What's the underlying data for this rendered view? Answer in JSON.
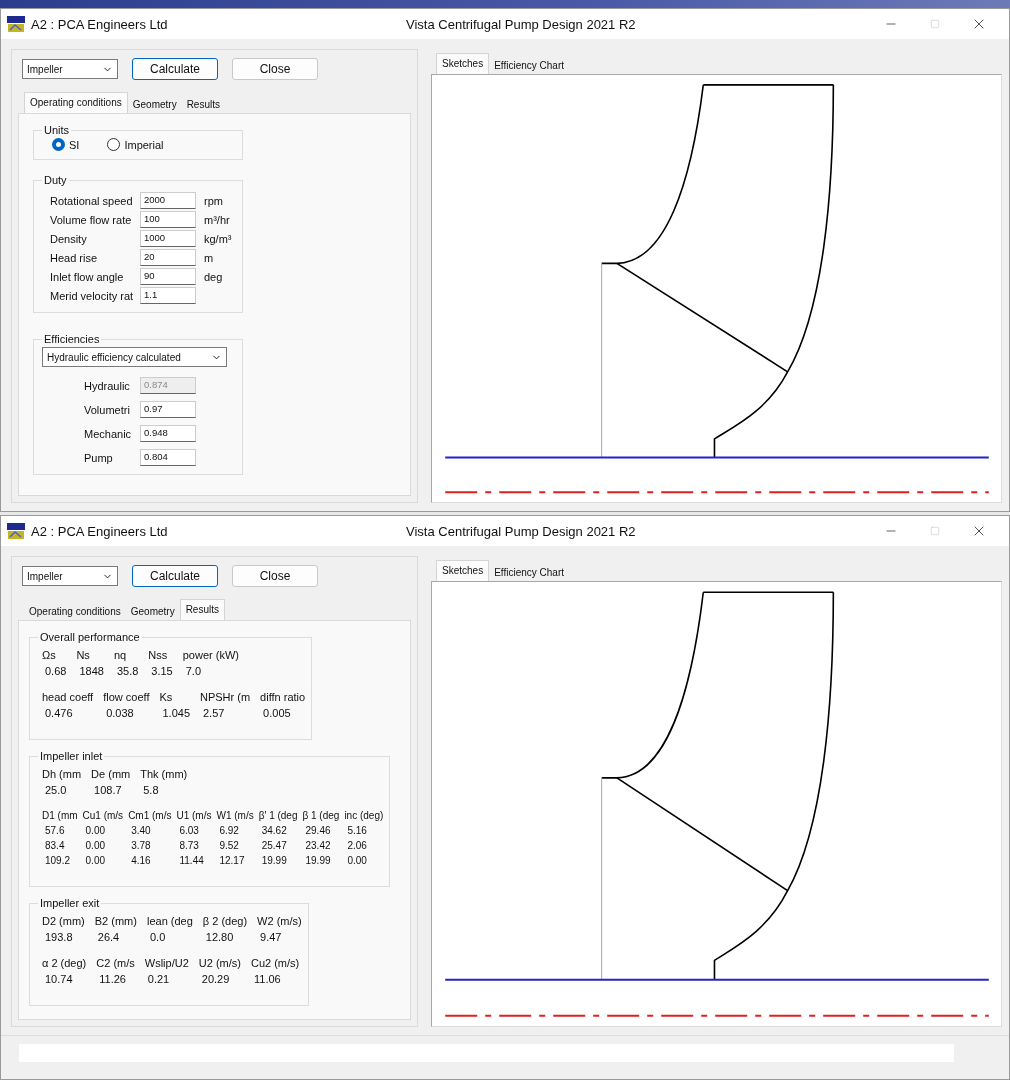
{
  "windows": [
    {
      "kind": "operating",
      "title_left": "A2 : PCA Engineers Ltd",
      "title": "Vista Centrifugal Pump Design 2021 R2",
      "component": "Impeller",
      "buttons": [
        "Calculate",
        "Close"
      ],
      "tabs": [
        {
          "label": "Operating conditions",
          "selected": true
        },
        {
          "label": "Geometry",
          "selected": false
        },
        {
          "label": "Results",
          "selected": false
        }
      ],
      "sketch_tabs": [
        {
          "label": "Sketches",
          "selected": true
        },
        {
          "label": "Efficiency Chart",
          "selected": false
        }
      ],
      "units": {
        "title": "Units",
        "options": [
          {
            "label": "SI",
            "selected": true
          },
          {
            "label": "Imperial",
            "selected": false
          }
        ]
      },
      "duty": {
        "title": "Duty",
        "rows": [
          {
            "label": "Rotational speed",
            "value": "2000",
            "unit": "rpm"
          },
          {
            "label": "Volume flow rate",
            "value": "100",
            "unit": "m³/hr"
          },
          {
            "label": "Density",
            "value": "1000",
            "unit": "kg/m³"
          },
          {
            "label": "Head rise",
            "value": "20",
            "unit": "m"
          },
          {
            "label": "Inlet flow angle",
            "value": "90",
            "unit": "deg"
          },
          {
            "label": "Merid velocity rat",
            "value": "1.1"
          }
        ]
      },
      "efficiencies": {
        "title": "Efficiencies",
        "mode": "Hydraulic efficiency calculated",
        "rows": [
          {
            "label": "Hydraulic",
            "value": "0.874",
            "disabled": true
          },
          {
            "label": "Volumetri",
            "value": "0.97",
            "disabled": false
          },
          {
            "label": "Mechanic",
            "value": "0.948",
            "disabled": false
          },
          {
            "label": "Pump",
            "value": "0.804",
            "disabled": false
          }
        ]
      }
    },
    {
      "kind": "results",
      "title_left": "A2 : PCA Engineers Ltd",
      "title": "Vista Centrifugal Pump Design 2021 R2",
      "component": "Impeller",
      "buttons": [
        "Calculate",
        "Close"
      ],
      "tabs": [
        {
          "label": "Operating conditions",
          "selected": false
        },
        {
          "label": "Geometry",
          "selected": false
        },
        {
          "label": "Results",
          "selected": true
        }
      ],
      "sketch_tabs": [
        {
          "label": "Sketches",
          "selected": true
        },
        {
          "label": "Efficiency Chart",
          "selected": false
        }
      ],
      "status_bar": true,
      "sections": [
        {
          "title": "Overall performance",
          "tables": [
            {
              "headers": [
                "Ωs",
                "Ns",
                "nq",
                "Nss",
                "power (kW)"
              ],
              "rows": [
                [
                  "0.68",
                  "1848",
                  "35.8",
                  "3.15",
                  "7.0"
                ]
              ]
            },
            {
              "headers": [
                "head coeff",
                "flow coeff",
                "Ks",
                "NPSHr (m",
                "diffn ratio"
              ],
              "rows": [
                [
                  "0.476",
                  "0.038",
                  "1.045",
                  "2.57",
                  "0.005"
                ]
              ]
            }
          ]
        },
        {
          "title": "Impeller inlet",
          "tables": [
            {
              "headers": [
                "Dh (mm",
                "De (mm",
                "Thk (mm)"
              ],
              "rows": [
                [
                  "25.0",
                  "108.7",
                  "5.8"
                ]
              ]
            },
            {
              "headers": [
                "D1 (mm",
                "Cu1 (m/s",
                "Cm1 (m/s",
                "U1 (m/s",
                "W1 (m/s",
                "β' 1 (deg",
                "β 1 (deg",
                "inc (deg)"
              ],
              "rows": [
                [
                  "57.6",
                  "0.00",
                  "3.40",
                  "6.03",
                  "6.92",
                  "34.62",
                  "29.46",
                  "5.16"
                ],
                [
                  "83.4",
                  "0.00",
                  "3.78",
                  "8.73",
                  "9.52",
                  "25.47",
                  "23.42",
                  "2.06"
                ],
                [
                  "109.2",
                  "0.00",
                  "4.16",
                  "11.44",
                  "12.17",
                  "19.99",
                  "19.99",
                  "0.00"
                ]
              ]
            }
          ]
        },
        {
          "title": "Impeller exit",
          "tables": [
            {
              "headers": [
                "D2 (mm)",
                "B2 (mm)",
                "lean (deg",
                "β 2 (deg)",
                "W2 (m/s)"
              ],
              "rows": [
                [
                  "193.8",
                  "26.4",
                  "0.0",
                  "12.80",
                  "9.47"
                ]
              ]
            },
            {
              "headers": [
                "α 2 (deg)",
                "C2 (m/s",
                "Wslip/U2",
                "U2 (m/s)",
                "Cu2 (m/s)"
              ],
              "rows": [
                [
                  "10.74",
                  "11.26",
                  "0.21",
                  "20.29",
                  "11.06"
                ]
              ]
            }
          ]
        }
      ]
    }
  ]
}
